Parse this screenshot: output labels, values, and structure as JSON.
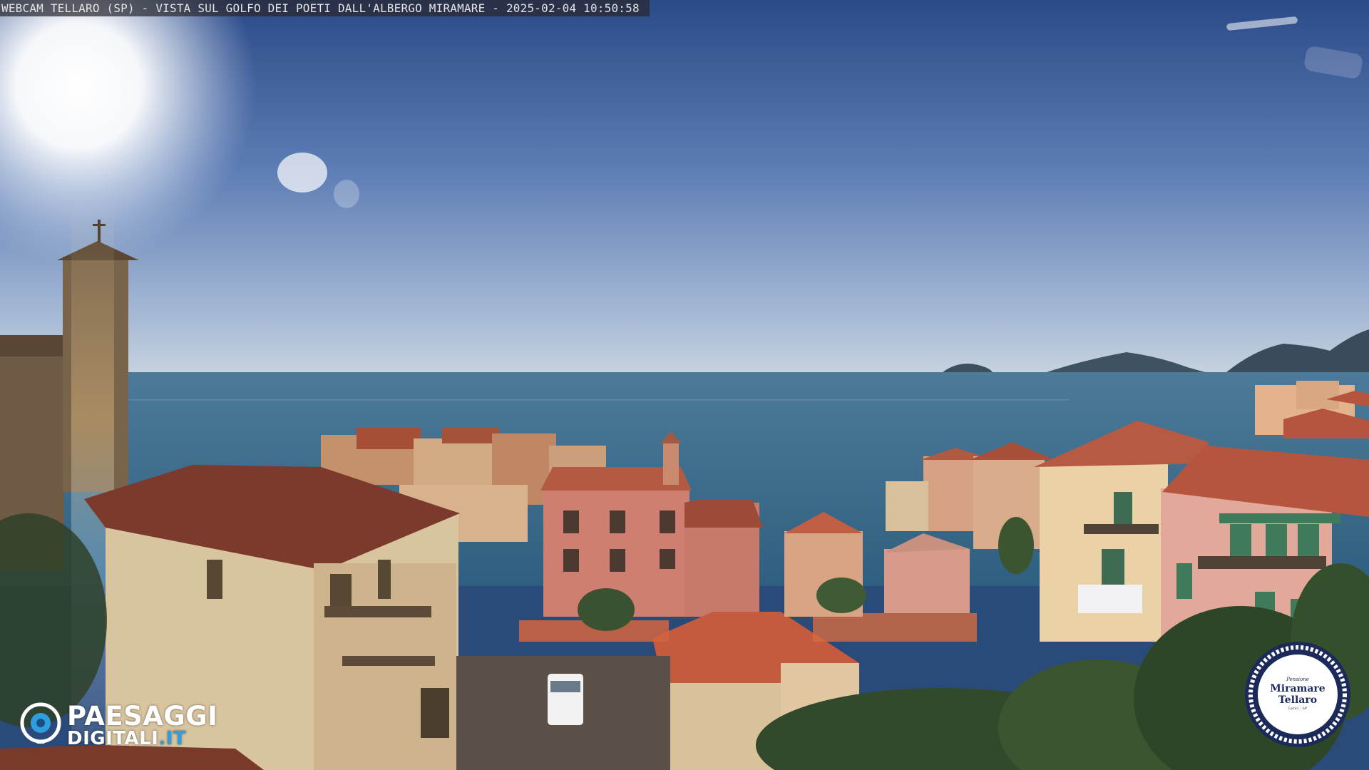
{
  "caption": {
    "text": "WEBCAM TELLARO (SP) - VISTA SUL GOLFO DEI POETI DALL'ALBERGO MIRAMARE - 2025-02-04 10:50:58"
  },
  "watermark": {
    "icon": "eye-icon",
    "line1": "PAESAGGI",
    "line2_main": "DIGITALI",
    "line2_tld": ".IT",
    "tld_color": "#2f9ee0"
  },
  "badge": {
    "line_small": "Pensione",
    "line_name1": "Miramare",
    "line_name2": "Tellaro",
    "line_tiny": "Lerici - SP"
  },
  "colors": {
    "sky_top": "#2f4f8c",
    "sky_horizon": "#b9c8dc",
    "sea": "#3f6f8f",
    "roof": "#b4553c"
  }
}
